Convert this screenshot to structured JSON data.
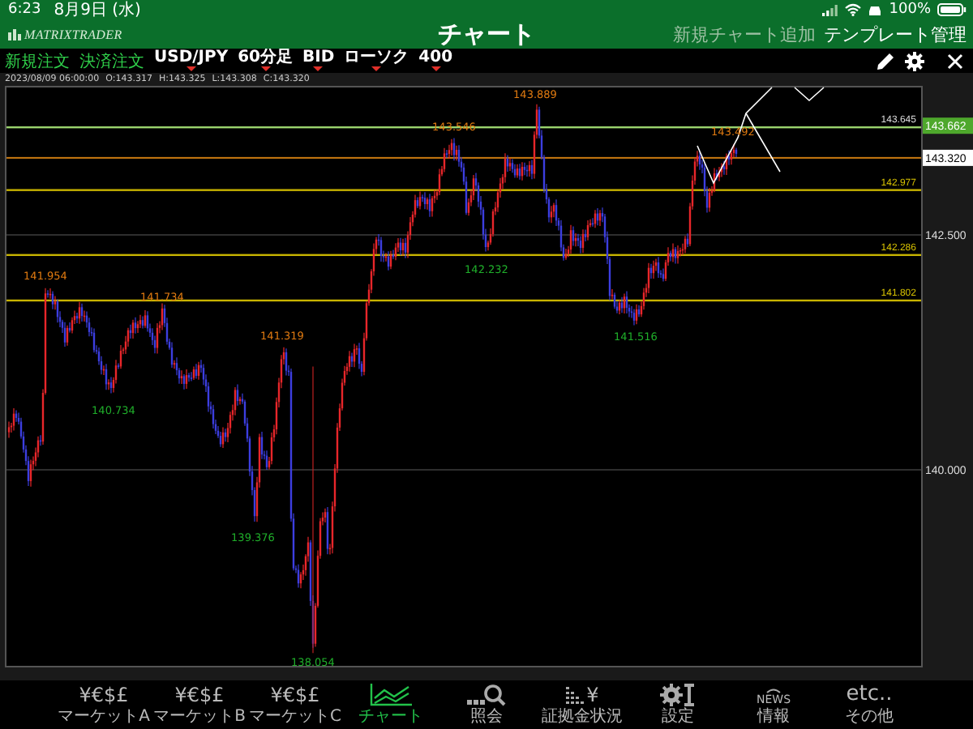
{
  "status_bar": {
    "time": "6:23",
    "date": "8月9日 (水)",
    "battery": "100%"
  },
  "header": {
    "logo": "MATRIXTRADER",
    "title": "チャート",
    "actions": [
      {
        "label": "新規チャート追加",
        "disabled": true
      },
      {
        "label": "テンプレート管理",
        "disabled": false
      }
    ]
  },
  "toolbar": {
    "order_buttons": [
      "新規注文",
      "決済注文"
    ],
    "selectors": [
      "USD/JPY",
      "60分足",
      "BID",
      "ローソク",
      "400"
    ]
  },
  "ohlc": {
    "datetime": "2023/08/09 06:00:00",
    "open": "O:143.317",
    "high": "H:143.325",
    "low": "L:143.308",
    "close": "C:143.320"
  },
  "chart": {
    "level_lines": [
      {
        "label": "143.645",
        "color": "#9ad46e"
      },
      {
        "label": "142.977",
        "color": "#c8b400"
      },
      {
        "label": "142.286",
        "color": "#c8b400"
      },
      {
        "label": "141.802",
        "color": "#c8b400"
      }
    ],
    "price_badges": [
      {
        "text": "143.662",
        "kind": "ask"
      },
      {
        "text": "143.320",
        "kind": "bid"
      }
    ],
    "axis_labels": [
      "142.500",
      "140.000"
    ],
    "annotations": [
      {
        "text": "143.889",
        "kind": "high"
      },
      {
        "text": "143.546",
        "kind": "high"
      },
      {
        "text": "143.492",
        "kind": "high"
      },
      {
        "text": "142.232",
        "kind": "low"
      },
      {
        "text": "141.954",
        "kind": "high"
      },
      {
        "text": "141.734",
        "kind": "high"
      },
      {
        "text": "141.516",
        "kind": "low"
      },
      {
        "text": "141.319",
        "kind": "high"
      },
      {
        "text": "140.734",
        "kind": "low"
      },
      {
        "text": "139.376",
        "kind": "low"
      },
      {
        "text": "138.054",
        "kind": "low"
      }
    ]
  },
  "tabs": [
    {
      "label": "マーケットA",
      "kind": "currency",
      "icon_text": "¥€$£",
      "selected": false
    },
    {
      "label": "マーケットB",
      "kind": "currency",
      "icon_text": "¥€$£",
      "selected": false
    },
    {
      "label": "マーケットC",
      "kind": "currency",
      "icon_text": "¥€$£",
      "selected": false
    },
    {
      "label": "チャート",
      "kind": "chart",
      "selected": true
    },
    {
      "label": "照会",
      "kind": "search",
      "selected": false
    },
    {
      "label": "証拠金状況",
      "kind": "margin",
      "icon_text": "¥",
      "selected": false
    },
    {
      "label": "設定",
      "kind": "settings",
      "selected": false
    },
    {
      "label": "情報",
      "kind": "news",
      "icon_text": "NEWS",
      "selected": false
    },
    {
      "label": "その他",
      "kind": "text",
      "icon_text": "etc..",
      "selected": false
    }
  ]
}
